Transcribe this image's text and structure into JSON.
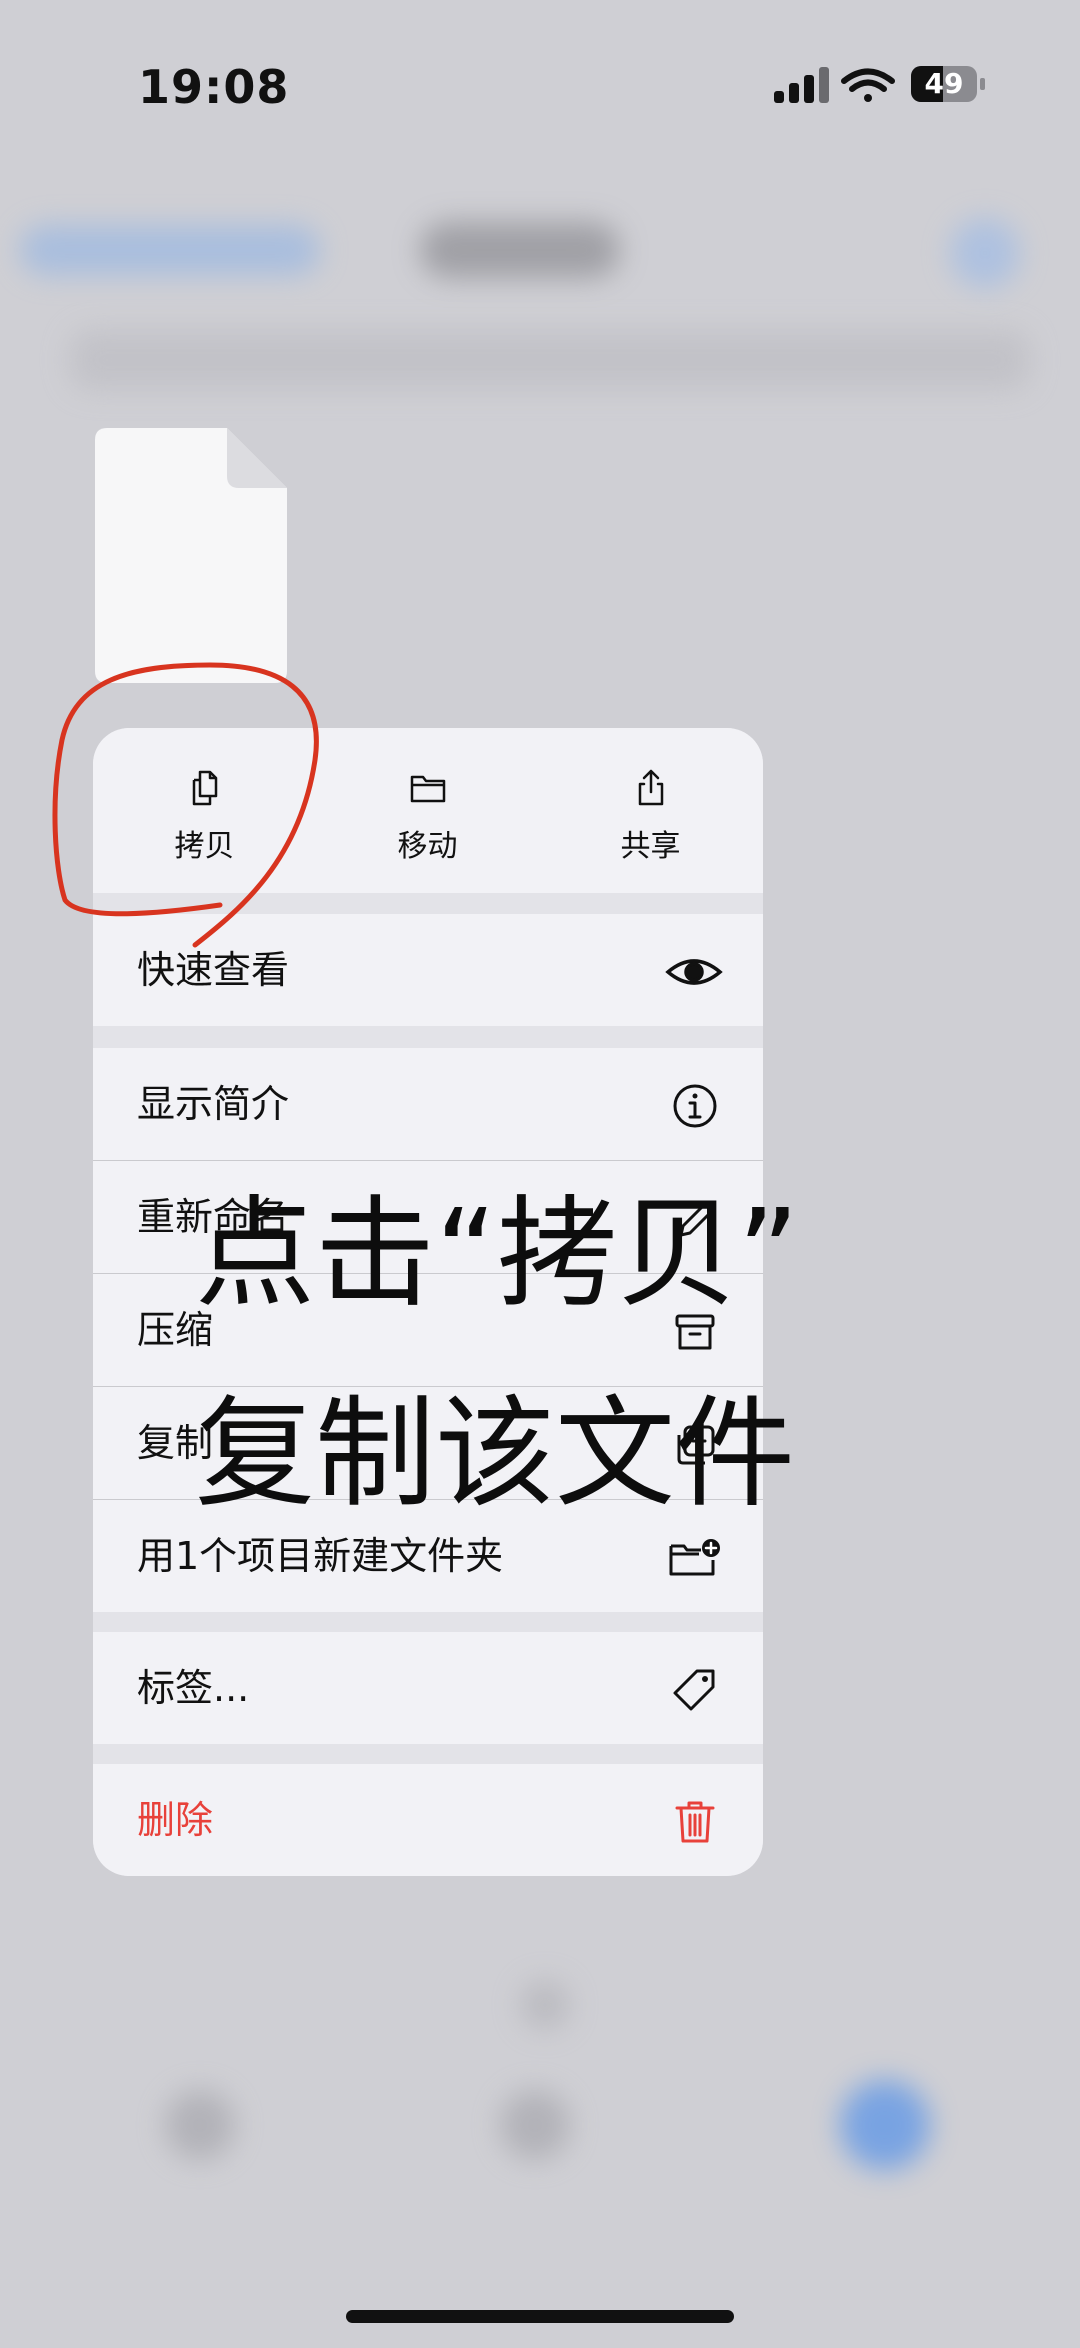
{
  "status_bar": {
    "time": "19:08",
    "battery": "49",
    "icons": [
      "signal-icon",
      "wifi-icon",
      "battery-icon"
    ]
  },
  "quick_actions": [
    {
      "label": "拷贝",
      "icon": "copy-icon"
    },
    {
      "label": "移动",
      "icon": "folder-icon"
    },
    {
      "label": "共享",
      "icon": "share-icon"
    }
  ],
  "menu": {
    "quick_look": {
      "label": "快速查看",
      "icon": "eye-icon"
    },
    "info_group": [
      {
        "label": "显示简介",
        "icon": "info-icon"
      },
      {
        "label": "重新命名",
        "icon": "pencil-icon"
      },
      {
        "label": "压缩",
        "icon": "archive-icon"
      },
      {
        "label": "复制",
        "icon": "duplicate-icon"
      },
      {
        "label": "用1个项目新建文件夹",
        "icon": "folder-add-icon"
      }
    ],
    "tags": {
      "label": "标签...",
      "icon": "tag-icon"
    },
    "delete": {
      "label": "删除",
      "icon": "trash-icon"
    }
  },
  "overlay_caption": {
    "line1": "点击“拷贝”",
    "line2": "复制该文件"
  },
  "colors": {
    "danger": "#e8413a",
    "annotation": "#d8341f",
    "menu_background": "#f2f2f6"
  }
}
